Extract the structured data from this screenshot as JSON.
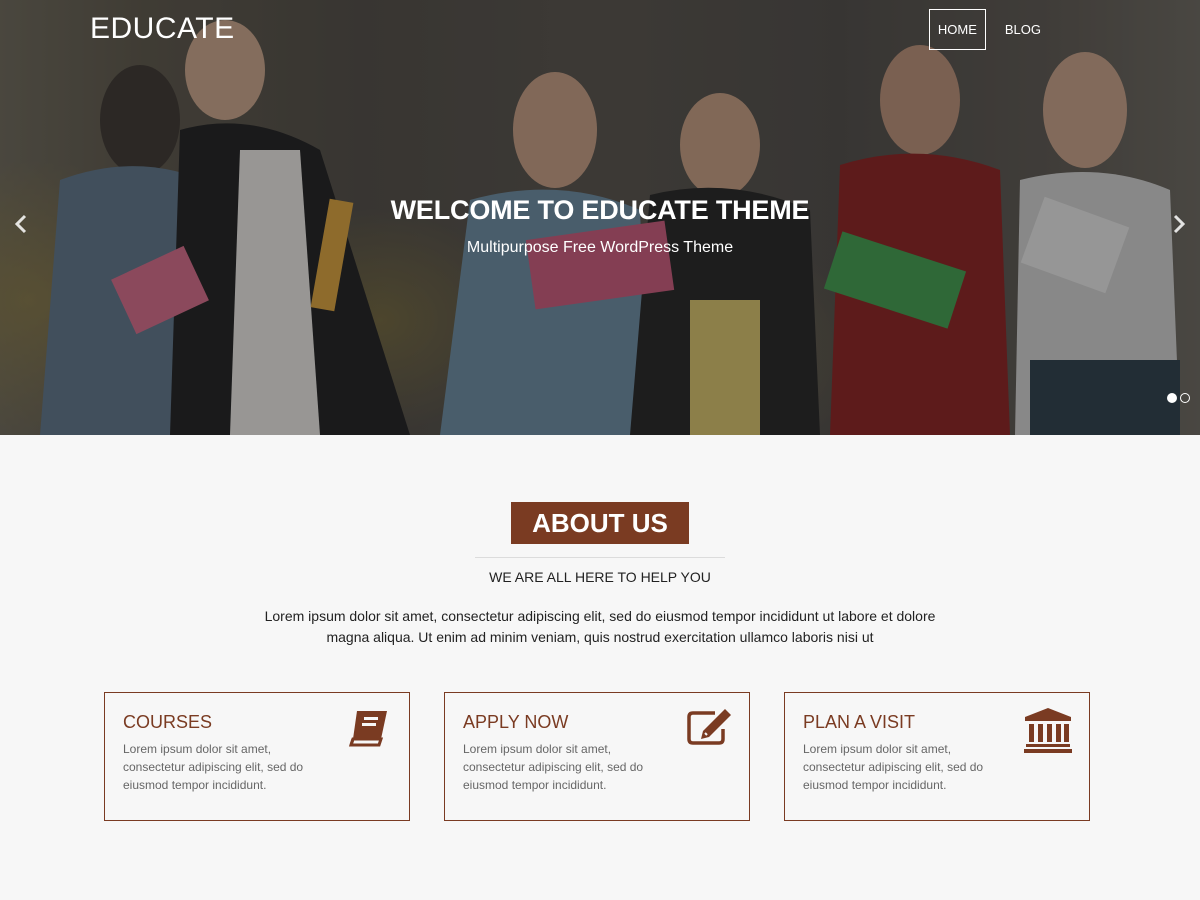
{
  "site": {
    "logo": "EDUCATE"
  },
  "nav": {
    "items": [
      {
        "label": "HOME",
        "active": true
      },
      {
        "label": "BLOG",
        "active": false
      }
    ]
  },
  "hero": {
    "title": "WELCOME TO EDUCATE THEME",
    "subtitle": "Multipurpose Free WordPress Theme",
    "prev_icon": "chevron-left-icon",
    "next_icon": "chevron-right-icon",
    "slides": 2,
    "active_slide": 1
  },
  "about": {
    "heading": "ABOUT US",
    "tagline": "WE ARE ALL HERE TO HELP YOU",
    "text": "Lorem ipsum dolor sit amet, consectetur adipiscing elit, sed do eiusmod tempor incididunt ut labore et dolore magna aliqua. Ut enim ad minim veniam, quis nostrud exercitation ullamco laboris nisi ut"
  },
  "cards": [
    {
      "title": "COURSES",
      "text": "Lorem ipsum dolor sit amet, consectetur adipiscing elit, sed do eiusmod tempor incididunt.",
      "icon": "book-icon"
    },
    {
      "title": "APPLY NOW",
      "text": "Lorem ipsum dolor sit amet, consectetur adipiscing elit, sed do eiusmod tempor incididunt.",
      "icon": "edit-icon"
    },
    {
      "title": "PLAN A VISIT",
      "text": "Lorem ipsum dolor sit amet, consectetur adipiscing elit, sed do eiusmod tempor incididunt.",
      "icon": "institution-icon"
    }
  ],
  "colors": {
    "accent": "#7a3b22",
    "background": "#f7f7f7"
  }
}
